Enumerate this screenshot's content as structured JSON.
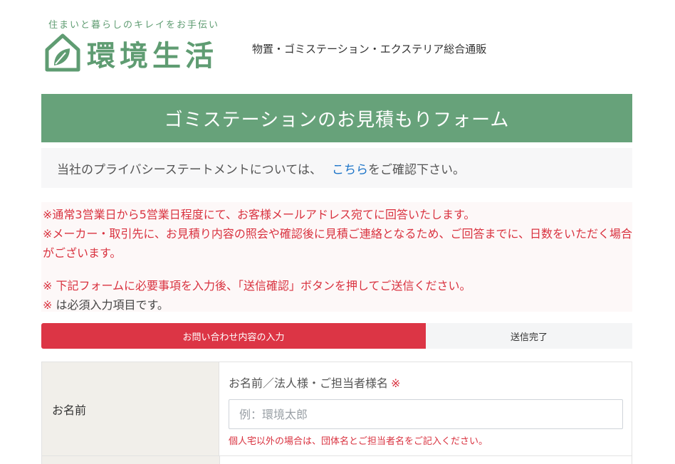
{
  "header": {
    "tagline": "住まいと暮らしのキレイをお手伝い",
    "site_name": "環境生活",
    "description": "物置・ゴミステーション・エクステリア総合通販"
  },
  "page": {
    "title": "ゴミステーションのお見積もりフォーム"
  },
  "privacy": {
    "text_before": "当社のプライバシーステートメントについては、",
    "link_label": "こちら",
    "text_after": "をご確認下さい。"
  },
  "notices": {
    "line1": "※通常3営業日から5営業日程度にて、お客様メールアドレス宛てに回答いたします。",
    "line2": "※メーカー・取引先に、お見積り内容の照会や確認後に見積ご連絡となるため、ご回答までに、日数をいただく場合がございます。",
    "line3": "※ 下記フォームに必要事項を入力後、「送信確認」ボタンを押してご送信ください。",
    "line4_mark": "※",
    "line4_text": " は必須入力項目です。"
  },
  "steps": [
    {
      "label": "お問い合わせ内容の入力",
      "active": true
    },
    {
      "label": "送信完了",
      "active": false
    }
  ],
  "form": {
    "name_row": {
      "label": "お名前",
      "field_title": "お名前／法人様・ご担当者様名",
      "required_mark": "※",
      "placeholder": "例：環境太郎",
      "value": "",
      "hint": "個人宅以外の場合は、団体名とご担当者名をご記入ください。"
    }
  },
  "colors": {
    "brand_green": "#67a27a",
    "logo_green": "#5f9c72",
    "alert_red": "#d9323f",
    "link_blue": "#1a73c8",
    "label_bg": "#f1efea"
  }
}
